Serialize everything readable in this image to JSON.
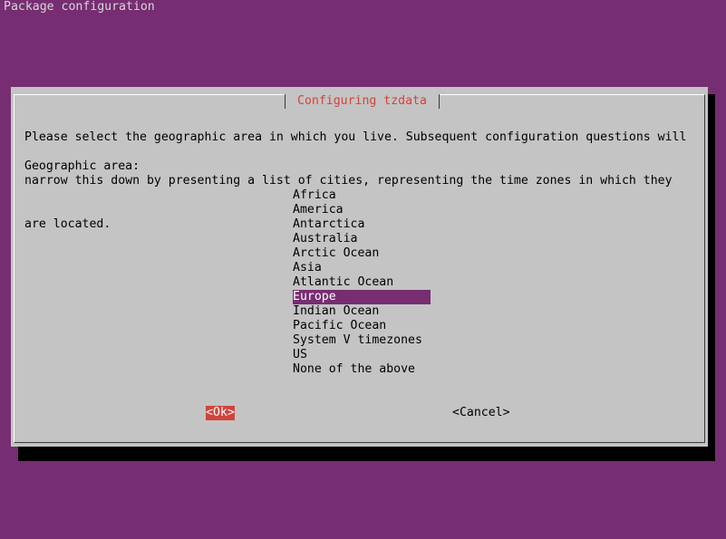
{
  "terminal": {
    "title": "Package configuration"
  },
  "dialog": {
    "title": "Configuring tzdata",
    "prompt_lines": [
      "Please select the geographic area in which you live. Subsequent configuration questions will",
      "narrow this down by presenting a list of cities, representing the time zones in which they",
      "are located."
    ],
    "list_label": "Geographic area:",
    "areas": [
      "Africa",
      "America",
      "Antarctica",
      "Australia",
      "Arctic Ocean",
      "Asia",
      "Atlantic Ocean",
      "Europe",
      "Indian Ocean",
      "Pacific Ocean",
      "System V timezones",
      "US",
      "None of the above"
    ],
    "selected_area": "Europe",
    "ok_label": "<Ok>",
    "cancel_label": "<Cancel>"
  },
  "colors": {
    "background": "#772d72",
    "dialog": "#c4c4c4",
    "title_text": "#d0443b",
    "selection": "#772d72",
    "focused_button": "#d0443b"
  }
}
